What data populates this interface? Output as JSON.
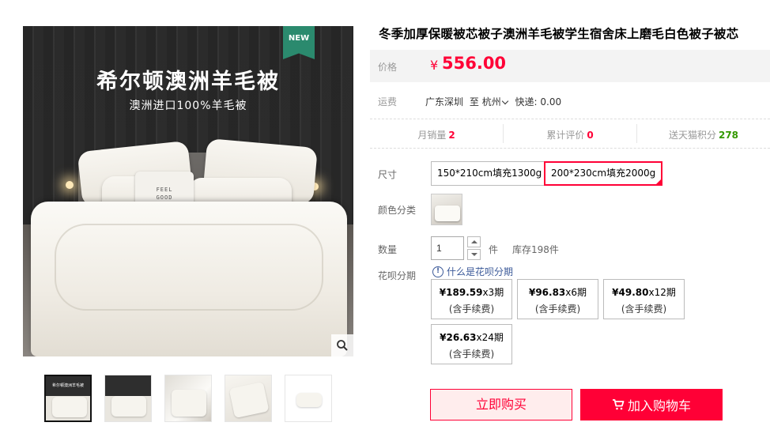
{
  "gallery": {
    "main_title": "希尔顿澳洲羊毛被",
    "main_subtitle": "澳洲进口100%羊毛被",
    "new_tag": "NEW",
    "pillow_text": "FEEL\nGOOD",
    "thumb_text": "希尔顿澳洲羊毛被",
    "zoom_icon": "magnifier-icon",
    "thumbnail_count": 5,
    "active_thumbnail": 1
  },
  "product": {
    "title": "冬季加厚保暖被芯被子澳洲羊毛被学生宿舍床上磨毛白色被子被芯",
    "price_label": "价格",
    "currency": "¥",
    "price": "556.00",
    "price_color": "#ff0036"
  },
  "shipping": {
    "label": "运费",
    "from": "广东深圳",
    "to_word": "至",
    "to": "杭州",
    "fee": "快递: 0.00"
  },
  "stats": [
    {
      "label": "月销量",
      "value": "2",
      "color": "#ff0036"
    },
    {
      "label": "累计评价",
      "value": "0",
      "color": "#ff0036"
    },
    {
      "label": "送天猫积分",
      "value": "278",
      "color": "#339900"
    }
  ],
  "size": {
    "label": "尺寸",
    "options": [
      "150*210cm填充1300g",
      "200*230cm填充2000g"
    ],
    "selected_index": 1
  },
  "color": {
    "label": "颜色分类"
  },
  "quantity": {
    "label": "数量",
    "value": "1",
    "unit": "件",
    "stock": "库存198件"
  },
  "huabei": {
    "label": "花呗分期",
    "help_text": "什么是花呗分期",
    "options": [
      {
        "price": "¥189.59",
        "periods": "x3期",
        "fee": "(含手续费)"
      },
      {
        "price": "¥96.83",
        "periods": "x6期",
        "fee": "(含手续费)"
      },
      {
        "price": "¥49.80",
        "periods": "x12期",
        "fee": "(含手续费)"
      },
      {
        "price": "¥26.63",
        "periods": "x24期",
        "fee": "(含手续费)"
      }
    ]
  },
  "actions": {
    "buy_now": "立即购买",
    "add_to_cart": "加入购物车"
  }
}
